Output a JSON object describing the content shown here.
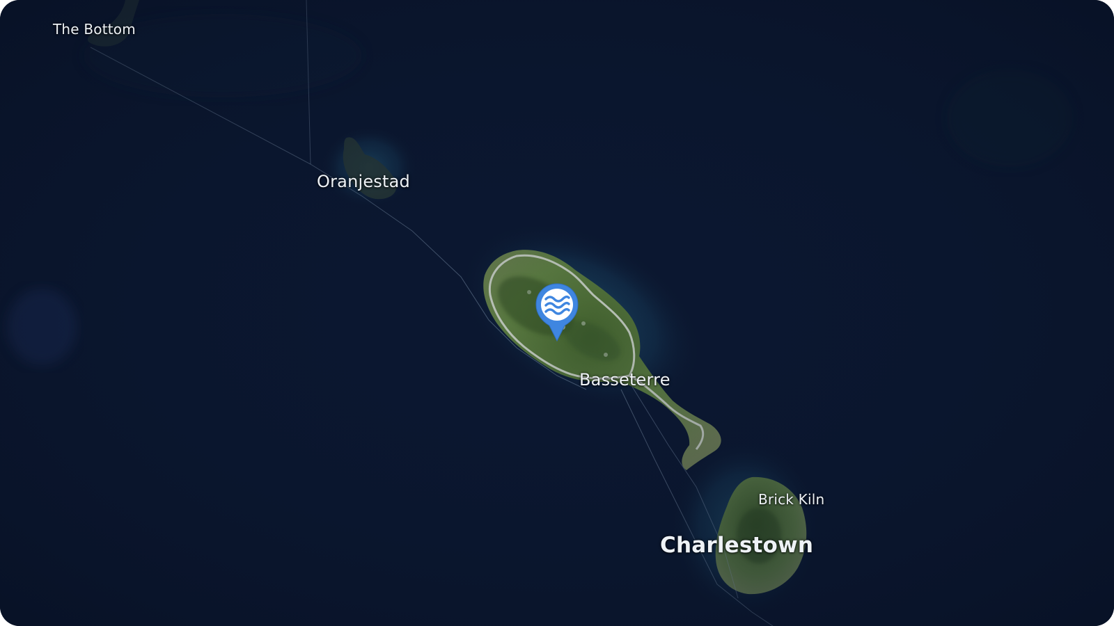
{
  "map": {
    "colors": {
      "ocean": "#0a1428",
      "land": "#4f6a3a",
      "road": "#cfd3cf",
      "marker": "#3f86e0"
    },
    "labels": {
      "the_bottom": "The Bottom",
      "oranjestad": "Oranjestad",
      "basseterre": "Basseterre",
      "brick_kiln": "Brick Kiln",
      "charlestown": "Charlestown"
    },
    "marker": {
      "icon": "water-waves-icon"
    }
  }
}
